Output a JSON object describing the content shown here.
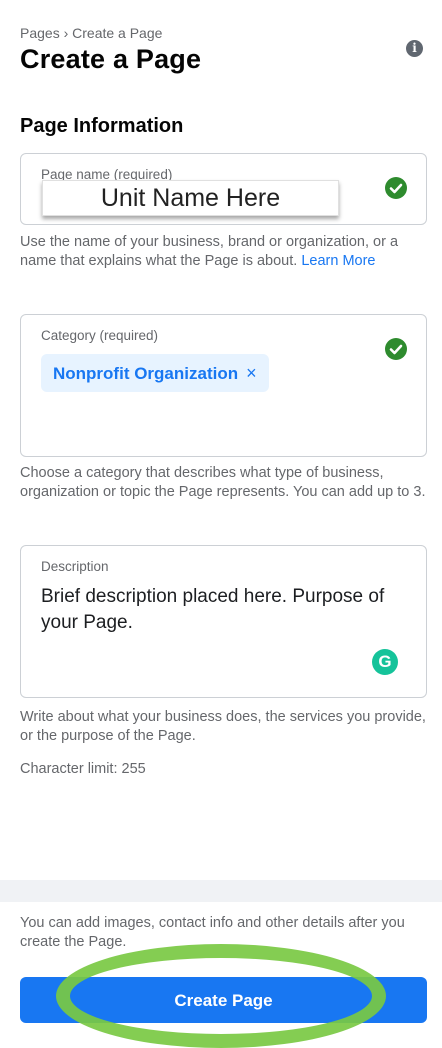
{
  "breadcrumb": "Pages › Create a Page",
  "title": "Create a Page",
  "section_heading": "Page Information",
  "page_name": {
    "label": "Page name (required)",
    "value": "Unit Name Here",
    "help": "Use the name of your business, brand or organization, or a name that explains what the Page is about.",
    "learn_more": "Learn More"
  },
  "category": {
    "label": "Category (required)",
    "chip_label": "Nonprofit Organization",
    "chip_remove": "×",
    "help": "Choose a category that describes what type of business, organization or topic the Page represents. You can add up to 3."
  },
  "description": {
    "label": "Description",
    "value": "Brief description placed here. Purpose of your Page.",
    "help": "Write about what your business does, the services you provide, or the purpose of the Page.",
    "char_limit": "Character limit: 255"
  },
  "footer": {
    "text": "You can add images, contact info and other details after you create the Page.",
    "create_button": "Create Page"
  },
  "colors": {
    "accent": "#1877f2",
    "check_green": "#2e8b2e",
    "highlight_ring": "#7ac943"
  }
}
